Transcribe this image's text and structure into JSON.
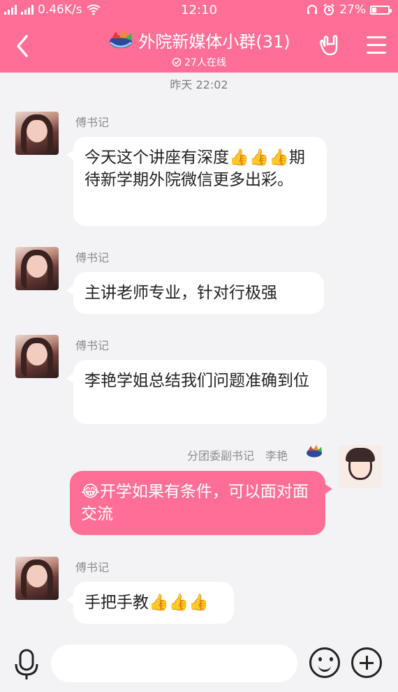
{
  "status_bar": {
    "network": "0.46K/s",
    "time": "12:10",
    "battery": "27%",
    "battery_level": 0.27
  },
  "header": {
    "title": "外院新媒体小群(31)",
    "online": "27人在线",
    "icons": [
      "back-icon",
      "group-logo-icon",
      "rock-hand-icon",
      "menu-icon"
    ]
  },
  "chat": {
    "timestamp": "昨天 22:02",
    "messages": [
      {
        "sender": "傅书记",
        "text": "今天这个讲座有深度👍👍👍期待新学期外院微信更多出彩。",
        "side": "left"
      },
      {
        "sender": "傅书记",
        "text": "主讲老师专业，针对行极强",
        "side": "left"
      },
      {
        "sender": "傅书记",
        "text": "李艳学姐总结我们问题准确到位",
        "side": "left"
      },
      {
        "sender": "分团委副书记　李艳",
        "text": "😂开学如果有条件，可以面对面交流",
        "side": "right"
      },
      {
        "sender": "傅书记",
        "text": "手把手教👍👍👍",
        "side": "left"
      }
    ]
  },
  "input_bar": {
    "icons": [
      "microphone-icon",
      "emoji-icon",
      "plus-icon"
    ]
  },
  "colors": {
    "accent": "#ff6f95",
    "background": "#f3f3f6"
  }
}
